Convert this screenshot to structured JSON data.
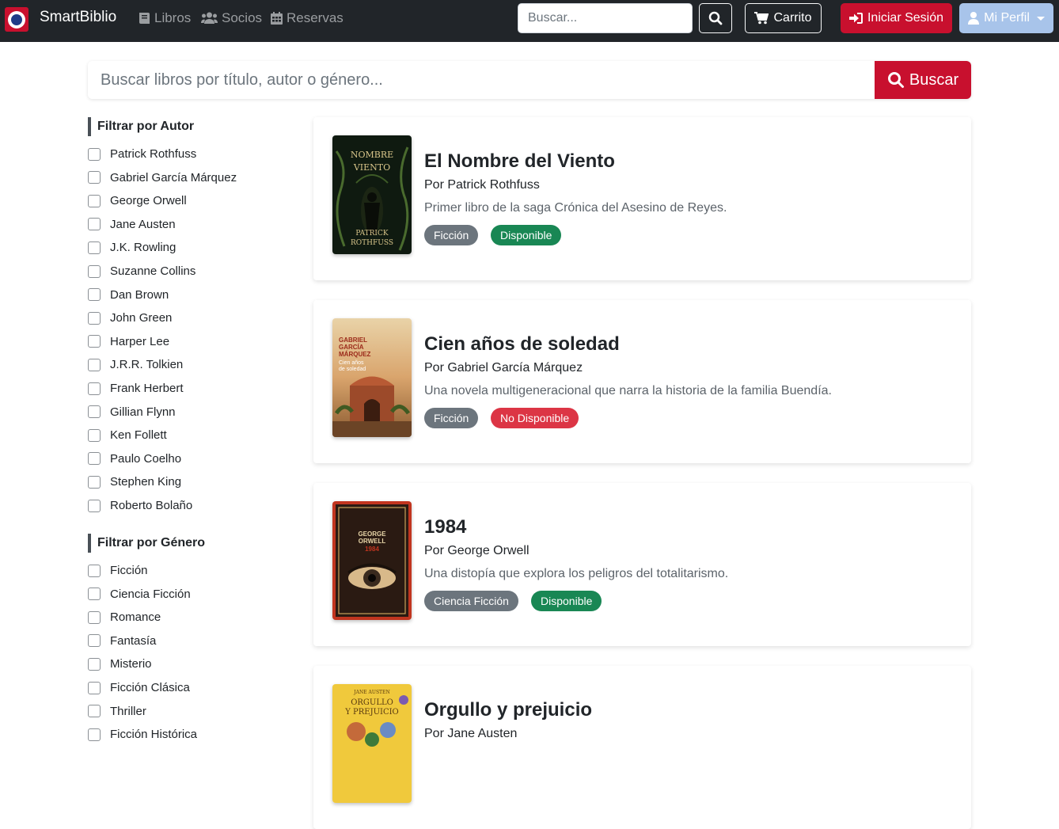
{
  "navbar": {
    "brand": "SmartBiblio",
    "links": [
      {
        "label": "Libros",
        "icon": "book-icon"
      },
      {
        "label": "Socios",
        "icon": "users-icon"
      },
      {
        "label": "Reservas",
        "icon": "calendar-icon"
      }
    ],
    "search_placeholder": "Buscar...",
    "cart_label": "Carrito",
    "login_label": "Iniciar Sesión",
    "profile_label": "Mi Perfil"
  },
  "main_search": {
    "placeholder": "Buscar libros por título, autor o género...",
    "button_label": "Buscar"
  },
  "filters": {
    "author_title": "Filtrar por Autor",
    "authors": [
      "Patrick Rothfuss",
      "Gabriel García Márquez",
      "George Orwell",
      "Jane Austen",
      "J.K. Rowling",
      "Suzanne Collins",
      "Dan Brown",
      "John Green",
      "Harper Lee",
      "J.R.R. Tolkien",
      "Frank Herbert",
      "Gillian Flynn",
      "Ken Follett",
      "Paulo Coelho",
      "Stephen King",
      "Roberto Bolaño"
    ],
    "genre_title": "Filtrar por Género",
    "genres": [
      "Ficción",
      "Ciencia Ficción",
      "Romance",
      "Fantasía",
      "Misterio",
      "Ficción Clásica",
      "Thriller",
      "Ficción Histórica"
    ]
  },
  "books": [
    {
      "title": "El Nombre del Viento",
      "author": "Por Patrick Rothfuss",
      "description": "Primer libro de la saga Crónica del Asesino de Reyes.",
      "genre": "Ficción",
      "status": "Disponible",
      "cover_text_top": "El Nombre del Viento",
      "cover_text_bottom": "Patrick Rothfuss"
    },
    {
      "title": "Cien años de soledad",
      "author": "Por Gabriel García Márquez",
      "description": "Una novela multigeneracional que narra la historia de la familia Buendía.",
      "genre": "Ficción",
      "status": "No Disponible",
      "cover_text_top": "GABRIEL GARCÍA MÁRQUEZ",
      "cover_text_bottom": "Cien años de soledad"
    },
    {
      "title": "1984",
      "author": "Por George Orwell",
      "description": "Una distopía que explora los peligros del totalitarismo.",
      "genre": "Ciencia Ficción",
      "status": "Disponible",
      "cover_text_top": "GEORGE ORWELL",
      "cover_text_bottom": "1984"
    },
    {
      "title": "Orgullo y prejuicio",
      "author": "Por Jane Austen",
      "description": "",
      "genre": "",
      "status": "",
      "cover_text_top": "JANE AUSTEN",
      "cover_text_bottom": "ORGULLO Y PREJUICIO"
    }
  ],
  "colors": {
    "accent": "#c8102e",
    "available": "#198754",
    "unavailable": "#dc3545",
    "genre": "#6c757d",
    "navbar": "#212529"
  }
}
